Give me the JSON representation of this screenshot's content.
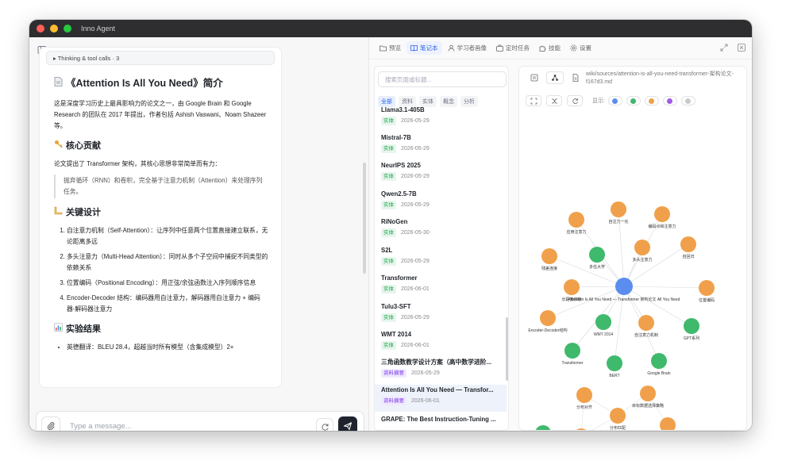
{
  "app": {
    "title": "Inno Agent"
  },
  "colors": {
    "close": "#ff5f57",
    "minimize": "#febc2e",
    "maximize": "#28c840",
    "accent": "#2563eb",
    "node_orange": "#f0a04b",
    "node_green": "#3fb96b",
    "node_blue": "#5b8def",
    "node_purple": "#a259e6",
    "node_gray": "#c9c9c9"
  },
  "chat": {
    "thinking": "▸ Thinking & tool calls · 3",
    "title_icon": "page-icon",
    "title": "《Attention Is All You Need》简介",
    "intro": "这是深度学习历史上最具影响力的论文之一，由 Google Brain 和 Google Research 的团队在 2017 年提出，作者包括 Ashish Vaswani、Noam Shazeer 等。",
    "h_contrib": "核心贡献",
    "contrib_text": "论文提出了 Transformer 架构，其核心思想非常简单而有力：",
    "quote": "抛弃循环（RNN）和卷积，完全基于注意力机制（Attention）来处理序列任务。",
    "h_design": "关键设计",
    "design_items": [
      "自注意力机制（Self-Attention）：让序列中任意两个位置直接建立联系，无论距离多远",
      "多头注意力（Multi-Head Attention）：同时从多个子空间中捕捉不同类型的依赖关系",
      "位置编码（Positional Encoding）：用正弦/余弦函数注入序列顺序信息",
      "Encoder-Decoder 结构：编码器用自注意力，解码器用自注意力 + 编码器-解码器注意力"
    ],
    "h_results": "实验结果",
    "result_item": "英德翻译：BLEU 28.4，超越当时所有模型（含集成模型）2+",
    "input_placeholder": "Type a message..."
  },
  "tabs": [
    {
      "label": "预览",
      "icon": "folder-icon"
    },
    {
      "label": "笔记本",
      "icon": "book-icon"
    },
    {
      "label": "学习者画像",
      "icon": "user-icon"
    },
    {
      "label": "定时任务",
      "icon": "briefcase-icon"
    },
    {
      "label": "技能",
      "icon": "puzzle-icon"
    },
    {
      "label": "设置",
      "icon": "gear-icon"
    }
  ],
  "notebook": {
    "search_placeholder": "搜索页面或标题...",
    "filters": [
      "全部",
      "资料",
      "实体",
      "概念",
      "分析"
    ],
    "docs": [
      {
        "title": "Llama3.1-405B",
        "tag": "实体",
        "date": "2026-05-29"
      },
      {
        "title": "Mistral-7B",
        "tag": "实体",
        "date": "2026-05-29"
      },
      {
        "title": "NeurIPS 2025",
        "tag": "实体",
        "date": "2026-05-29"
      },
      {
        "title": "Qwen2.5-7B",
        "tag": "实体",
        "date": "2026-05-29"
      },
      {
        "title": "RiNoGen",
        "tag": "实体",
        "date": "2026-05-30"
      },
      {
        "title": "S2L",
        "tag": "实体",
        "date": "2026-05-29"
      },
      {
        "title": "Transformer",
        "tag": "实体",
        "date": "2026-06-01"
      },
      {
        "title": "Tulu3-SFT",
        "tag": "实体",
        "date": "2026-05-29"
      },
      {
        "title": "WMT 2014",
        "tag": "实体",
        "date": "2026-06-01"
      },
      {
        "title": "三角函数教学设计方案（高中数学进阶...",
        "tag": "资料摘要",
        "date": "2026-05-29"
      },
      {
        "title": "Attention Is All You Need — Transfor...",
        "tag": "资料摘要",
        "date": "2026-06-01"
      },
      {
        "title": "GRAPE: The Best Instruction-Tuning ...",
        "tag": "",
        "date": ""
      }
    ]
  },
  "graph": {
    "path": "wiki/sources/attention-is-all-you-need-transformer-架构论文-f167d3.md",
    "show_label": "显示:",
    "legend": [
      "#5b8def",
      "#3fb96b",
      "#f0a04b",
      "#a259e6",
      "#c9c9c9"
    ],
    "center_label": "Attention Is All You Need — Transformer 架构论文 All You Need",
    "nodes": [
      {
        "label": "应用注意力",
        "color": "orange"
      },
      {
        "label": "自注力一化",
        "color": "orange"
      },
      {
        "label": "编码点和注意力",
        "color": "orange"
      },
      {
        "label": "多任大学",
        "color": "green"
      },
      {
        "label": "多头注意力",
        "color": "orange"
      },
      {
        "label": "自回归",
        "color": "orange"
      },
      {
        "label": "残差连接",
        "color": "orange"
      },
      {
        "label": "长距离依赖",
        "color": "orange"
      },
      {
        "label": "位置编码",
        "color": "orange"
      },
      {
        "label": "Encoder-Decoder结构",
        "color": "orange"
      },
      {
        "label": "WMT 2014",
        "color": "green"
      },
      {
        "label": "自注意力机制",
        "color": "orange"
      },
      {
        "label": "GPT系列",
        "color": "green"
      },
      {
        "label": "Transformer",
        "color": "green"
      },
      {
        "label": "BERT",
        "color": "green"
      },
      {
        "label": "Google Brain",
        "color": "green"
      },
      {
        "label": "分布对齐",
        "color": "orange"
      },
      {
        "label": "目标数据选择策略",
        "color": "orange"
      },
      {
        "label": "分布匹配",
        "color": "orange"
      },
      {
        "label": "自监督训练",
        "color": "orange"
      },
      {
        "label": "",
        "color": "green"
      },
      {
        "label": "",
        "color": "orange"
      }
    ]
  }
}
